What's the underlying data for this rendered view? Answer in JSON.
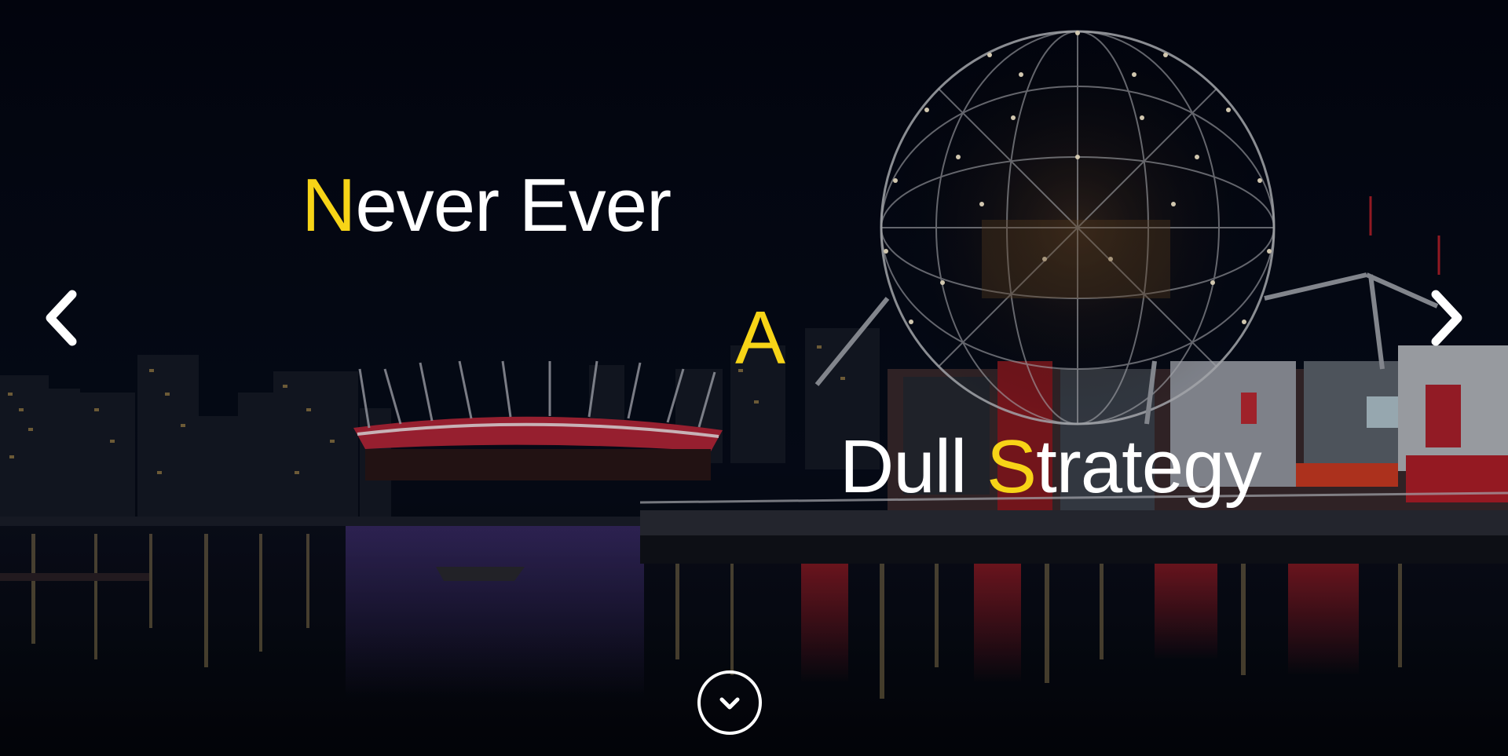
{
  "hero": {
    "line1": {
      "accent": "N",
      "rest": "ever Ever"
    },
    "line2": {
      "accent": "A"
    },
    "line3": {
      "before": "Dull ",
      "accent": "S",
      "rest": "trategy"
    }
  },
  "controls": {
    "prev_icon": "chevron-left-icon",
    "next_icon": "chevron-right-icon",
    "scroll_icon": "chevron-down-icon"
  },
  "colors": {
    "accent": "#f7d417",
    "text": "#ffffff",
    "background": "#04070f"
  }
}
